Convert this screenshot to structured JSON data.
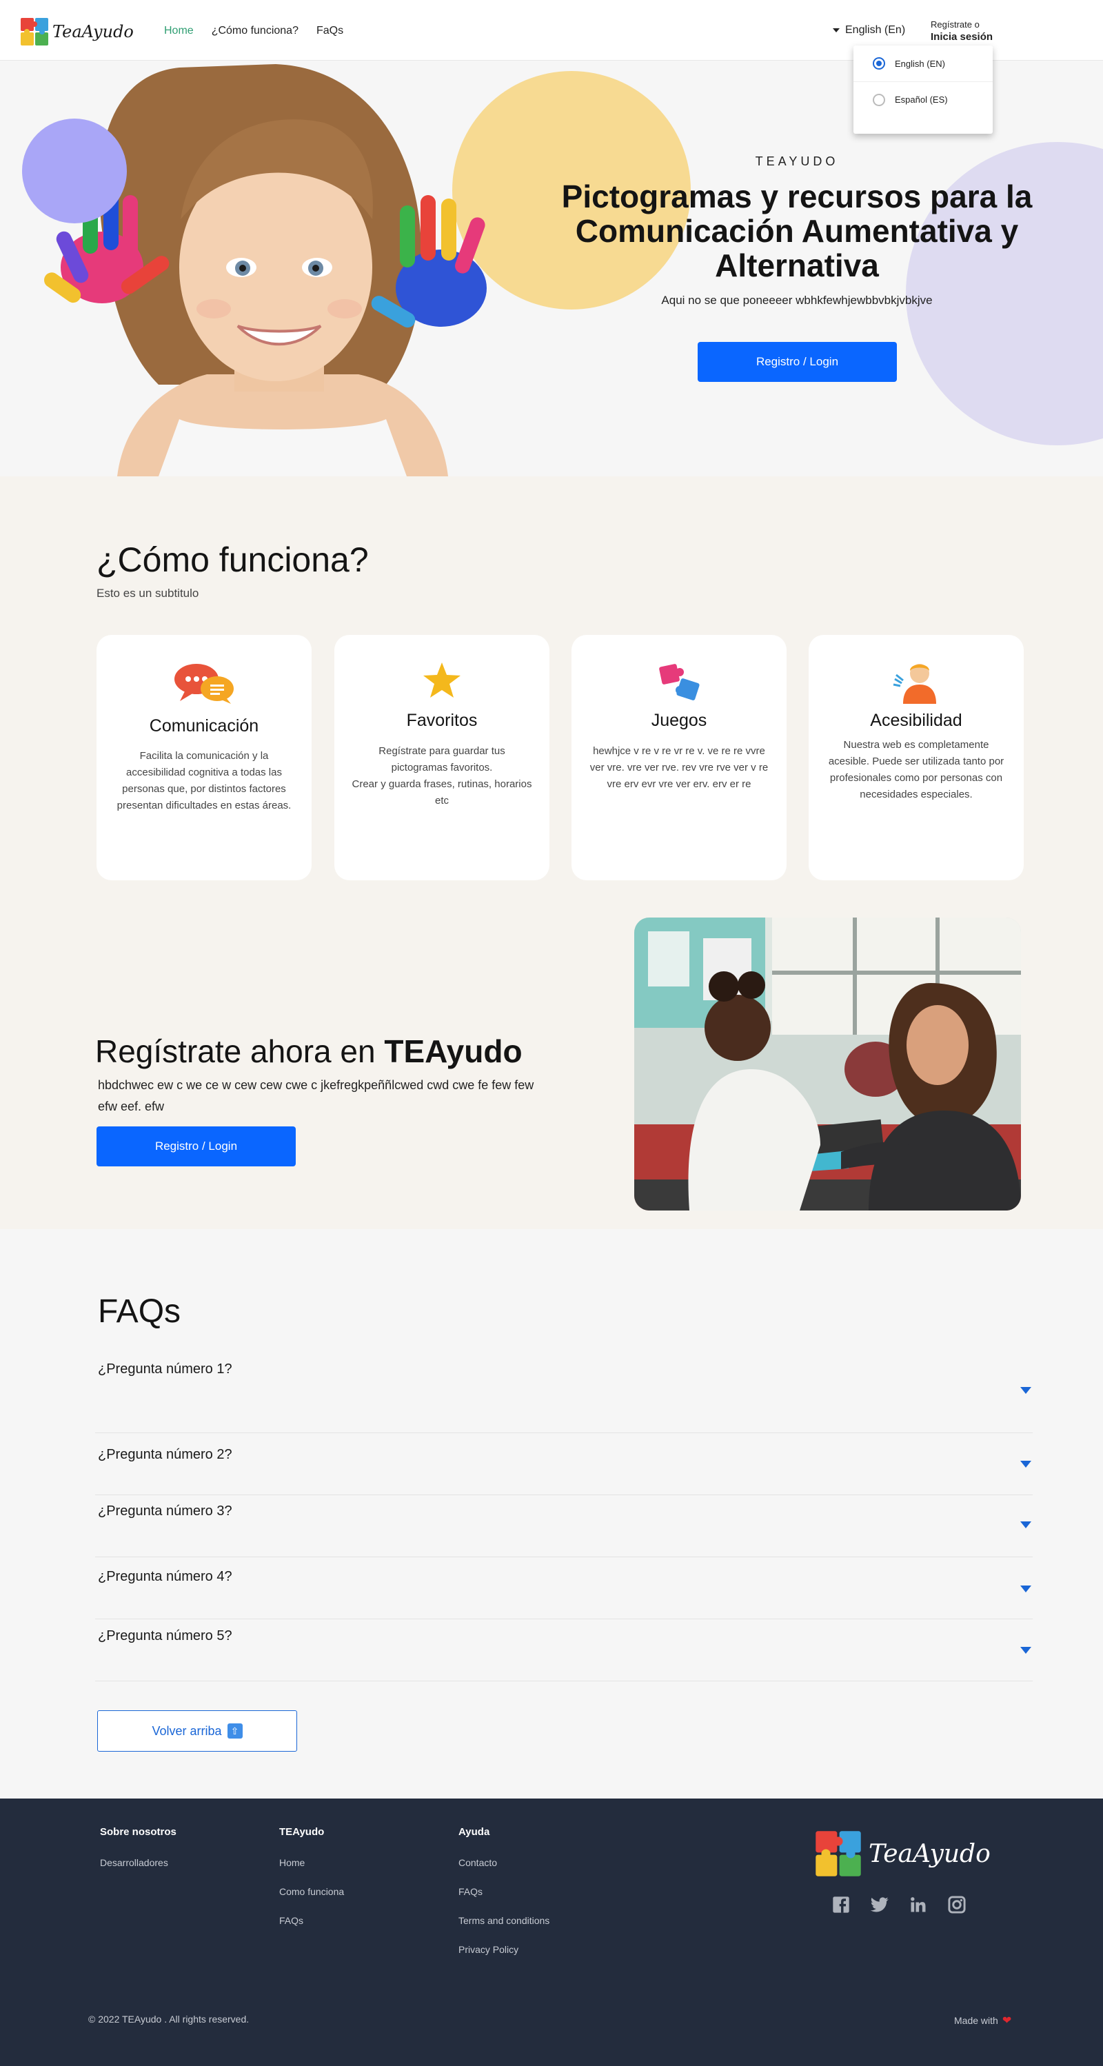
{
  "brand": {
    "name": "TeaAyudo"
  },
  "nav": {
    "links": [
      {
        "label": "Home",
        "active": true
      },
      {
        "label": "¿Cómo funciona?",
        "active": false
      },
      {
        "label": "FaQs",
        "active": false
      }
    ],
    "language": "English (En)",
    "register_prompt": "Regístrate o",
    "login_label": "Inicia sesión"
  },
  "language_menu": {
    "options": [
      {
        "label": "English (EN)",
        "selected": true
      },
      {
        "label": "Español (ES)",
        "selected": false
      }
    ]
  },
  "hero": {
    "eyebrow": "TEAYUDO",
    "title": "Pictogramas y recursos para la Comunicación Aumentativa y Alternativa",
    "subtitle": "Aqui no se que poneeeer wbhkfewhjewbbvbkjvbkjve",
    "cta": "Registro / Login"
  },
  "how": {
    "title": "¿Cómo funciona?",
    "subtitle": "Esto es un subtitulo",
    "cards": [
      {
        "icon": "speech-bubbles-icon",
        "title": "Comunicación",
        "text": "Facilita la comunicación y la accesibilidad cognitiva a todas las personas que, por distintos factores presentan dificultades en estas áreas."
      },
      {
        "icon": "star-icon",
        "title": "Favoritos",
        "text": "Regístrate para guardar tus pictogramas favoritos.\nCrear y guarda frases, rutinas, horarios etc"
      },
      {
        "icon": "puzzle-icon",
        "title": "Juegos",
        "text": "hewhjce v re v re vr re v. ve re re vvre ver vre. vre ver rve. rev vre rve ver v re vre erv evr vre ver erv. erv er re"
      },
      {
        "icon": "accessibility-person-icon",
        "title": "Acesibilidad",
        "text": "Nuestra web es completamente acesible. Puede ser utilizada tanto por profesionales como por personas con necesidades especiales."
      }
    ]
  },
  "register": {
    "title_prefix": "Regístrate ahora en ",
    "title_brand": "TEAyudo",
    "body": "hbdchwec ew c we ce w cew cew cwe c jkefregkpeññlcwed cwd cwe  fe few few efw eef. efw",
    "cta": "Registro / Login"
  },
  "faq": {
    "title": "FAQs",
    "items": [
      {
        "question": "¿Pregunta número 1?"
      },
      {
        "question": "¿Pregunta número 2?"
      },
      {
        "question": "¿Pregunta número 3?"
      },
      {
        "question": "¿Pregunta número 4?"
      },
      {
        "question": "¿Pregunta número 5?"
      }
    ],
    "back_to_top": "Volver arriba"
  },
  "footer": {
    "columns": [
      {
        "title": "Sobre nosotros",
        "links": [
          "Desarrolladores"
        ]
      },
      {
        "title": "TEAyudo",
        "links": [
          "Home",
          "Como funciona",
          "FAQs"
        ]
      },
      {
        "title": "Ayuda",
        "links": [
          "Contacto",
          "FAQs",
          "Terms and conditions",
          "Privacy Policy"
        ]
      }
    ],
    "brand": "TeaAyudo",
    "socials": [
      "facebook-icon",
      "twitter-icon",
      "linkedin-icon",
      "instagram-icon"
    ],
    "copyright": "© 2022 TEAyudo  . All rights reserved.",
    "made_with": "Made with"
  },
  "colors": {
    "primary_button": "#0a66ff",
    "active_nav": "#2f9e72",
    "footer_bg": "#232c3d",
    "how_bg": "#f6f3ee",
    "accent_blue": "#1a66d6"
  }
}
